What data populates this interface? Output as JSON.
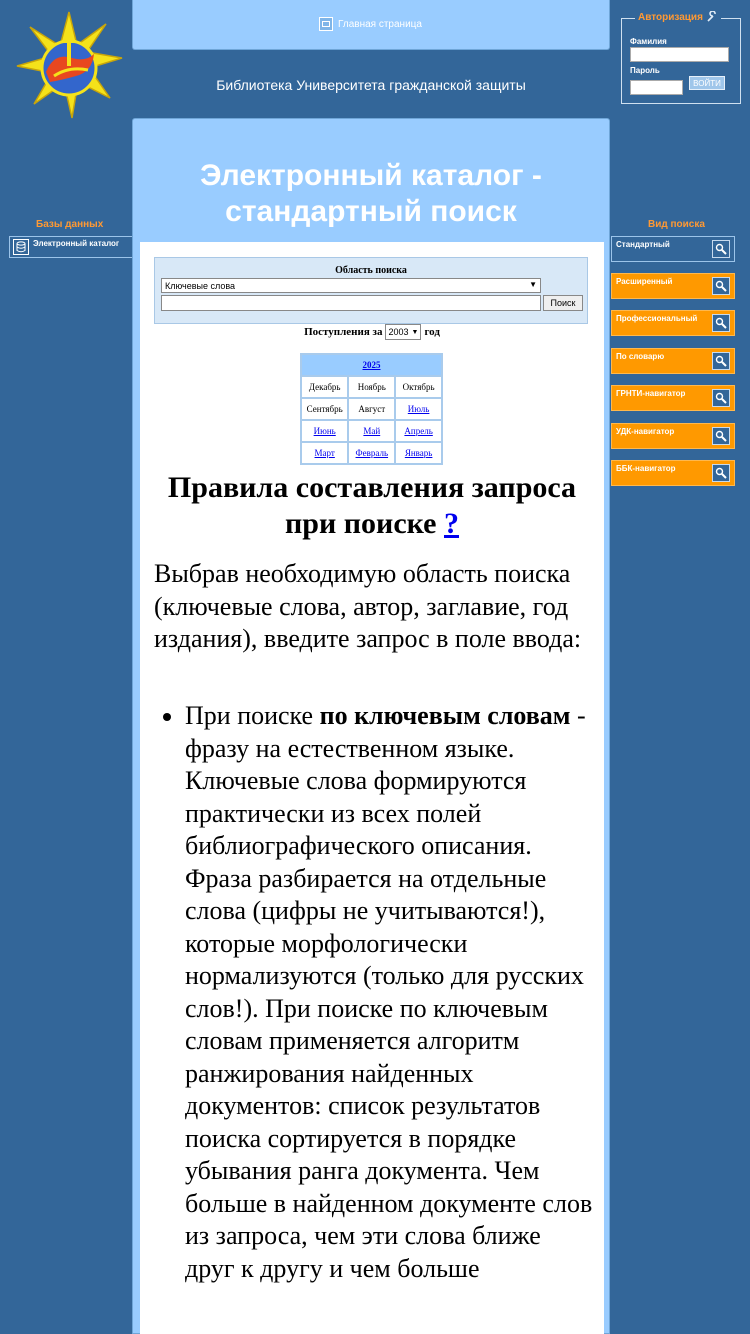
{
  "header": {
    "home_link": "Главная страница",
    "library_title": "Библиотека Университета гражданской защиты"
  },
  "auth": {
    "title": "Авторизация",
    "surname_label": "Фамилия",
    "password_label": "Пароль",
    "login_button": "ВОЙТИ"
  },
  "left_sidebar": {
    "heading": "Базы данных",
    "items": [
      {
        "label": "Электронный каталог"
      }
    ]
  },
  "right_sidebar": {
    "heading": "Вид поиска",
    "items": [
      {
        "label": "Стандартный"
      },
      {
        "label": "Расширенный"
      },
      {
        "label": "Профессиональный"
      },
      {
        "label": "По словарю"
      },
      {
        "label": "ГРНТИ-навигатор"
      },
      {
        "label": "УДК-навигатор"
      },
      {
        "label": "ББК-навигатор"
      }
    ]
  },
  "main": {
    "title": "Электронный каталог - стандартный поиск"
  },
  "search": {
    "area_label": "Область поиска",
    "area_selected": "Ключевые слова",
    "query_value": "",
    "button": "Поиск"
  },
  "arrivals": {
    "label_before": "Поступления за",
    "year": "2003",
    "label_after": "год"
  },
  "calendar": {
    "year": "2025",
    "rows": [
      [
        {
          "text": "Декабрь",
          "link": false
        },
        {
          "text": "Ноябрь",
          "link": false
        },
        {
          "text": "Октябрь",
          "link": false
        }
      ],
      [
        {
          "text": "Сентябрь",
          "link": false
        },
        {
          "text": "Август",
          "link": false
        },
        {
          "text": "Июль",
          "link": true
        }
      ],
      [
        {
          "text": "Июнь",
          "link": true
        },
        {
          "text": "Май",
          "link": true
        },
        {
          "text": "Апрель",
          "link": true
        }
      ],
      [
        {
          "text": "Март",
          "link": true
        },
        {
          "text": "Февраль",
          "link": true
        },
        {
          "text": "Январь",
          "link": true
        }
      ]
    ]
  },
  "rules": {
    "title": "Правила составления запроса при поиске",
    "help_link": "?",
    "intro": "Выбрав необходимую область поиска (ключевые слова, автор, заглавие, год издания), введите запрос в поле ввода:",
    "bullet_prefix": "При поиске ",
    "bullet_bold": "по ключевым словам",
    "bullet_text": " - фразу на естественном языке. Ключевые слова формируются практически из всех полей библиографического описания. Фраза разбирается на отдельные слова (цифры не учитываются!), которые морфологически нормализуются (только для русских слов!). При поиске по ключевым словам применяется алгоритм ранжирования найденных документов: список результатов поиска сортируется в порядке убывания ранга документа. Чем больше в найденном документе слов из запроса, чем эти слова ближе друг к другу и чем больше"
  }
}
